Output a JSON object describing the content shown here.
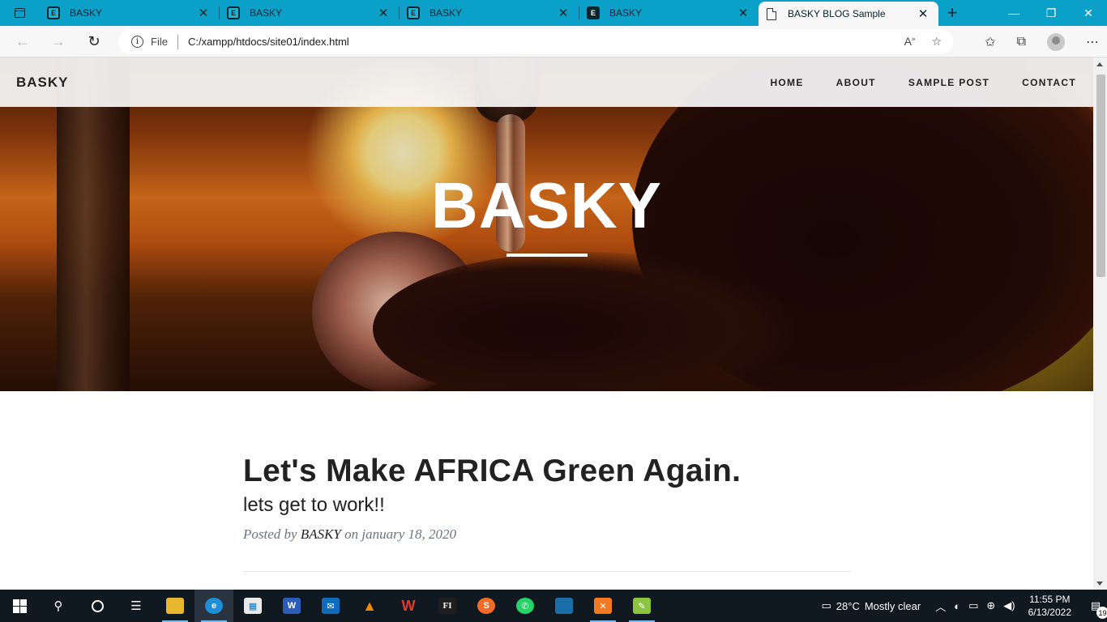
{
  "browser": {
    "tabs": [
      {
        "title": "BASKY",
        "icon": "site-favicon"
      },
      {
        "title": "BASKY",
        "icon": "site-favicon"
      },
      {
        "title": "BASKY",
        "icon": "site-favicon"
      },
      {
        "title": "BASKY",
        "icon": "site-favicon-dark"
      },
      {
        "title": "BASKY BLOG Sample",
        "icon": "page-icon",
        "active": true
      }
    ],
    "address": {
      "scheme_label": "File",
      "url": "C:/xampp/htdocs/site01/index.html"
    }
  },
  "site": {
    "brand": "BASKY",
    "nav": [
      "HOME",
      "ABOUT",
      "SAMPLE POST",
      "CONTACT"
    ],
    "hero_title": "BASKY",
    "post": {
      "title": "Let's Make AFRICA Green Again.",
      "subtitle": "lets get to work!!",
      "meta_prefix": "Posted by",
      "author": "BASKY",
      "meta_suffix": "on january 18, 2020"
    }
  },
  "taskbar": {
    "weather_temp": "28°C",
    "weather_text": "Mostly clear",
    "time": "11:55 PM",
    "date": "6/13/2022",
    "notification_count": "19",
    "apps": [
      "file-explorer",
      "edge",
      "store",
      "word",
      "mail",
      "vlc",
      "wps",
      "figma",
      "sublime",
      "whatsapp",
      "app-blue",
      "xampp",
      "notepad-plus"
    ]
  },
  "colors": {
    "tabbar": "#0aa0c8",
    "taskbar": "#101820",
    "accent": "#76b9ed"
  }
}
